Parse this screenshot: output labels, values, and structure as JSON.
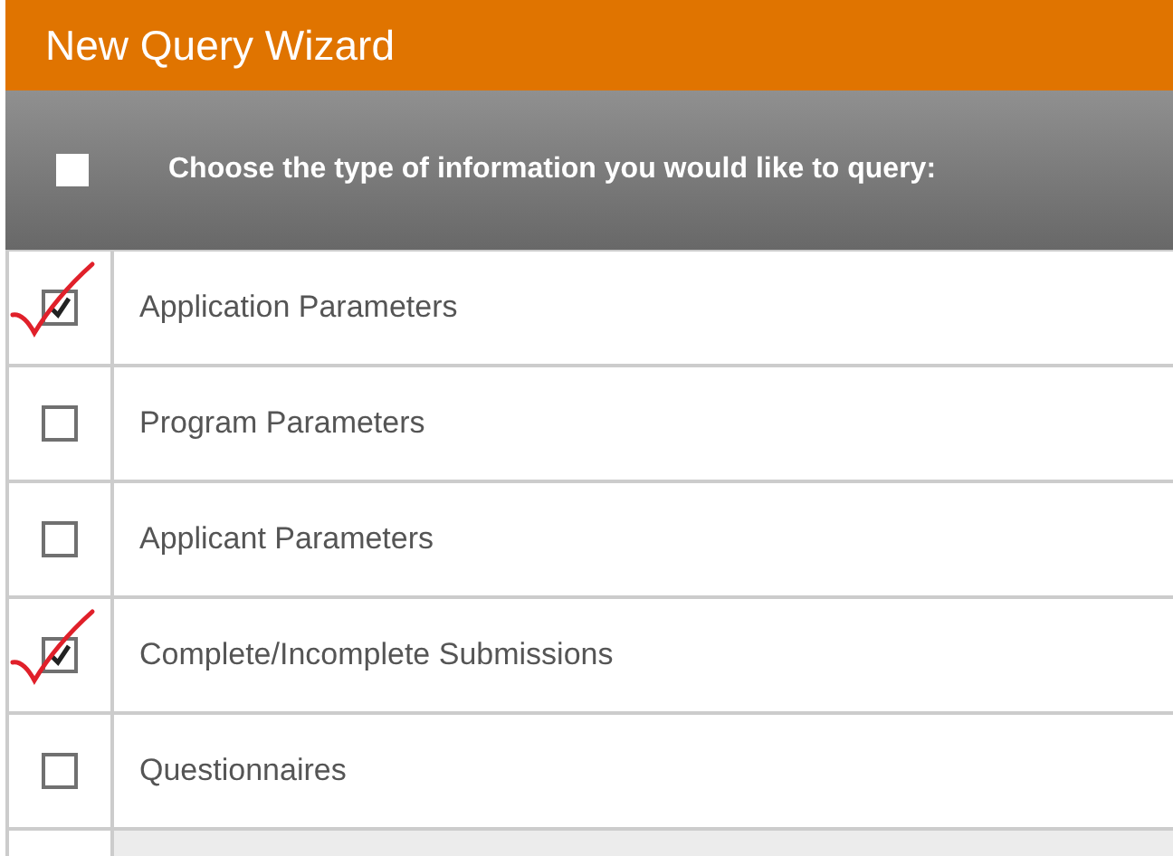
{
  "window": {
    "title": "New Query Wizard"
  },
  "header": {
    "select_all": {
      "checked": false
    },
    "prompt": "Choose the type of information you would like to query:"
  },
  "options": [
    {
      "label": "Application Parameters",
      "checked": true
    },
    {
      "label": "Program Parameters",
      "checked": false
    },
    {
      "label": "Applicant Parameters",
      "checked": false
    },
    {
      "label": "Complete/Incomplete Submissions",
      "checked": true
    },
    {
      "label": "Questionnaires",
      "checked": false
    }
  ]
}
